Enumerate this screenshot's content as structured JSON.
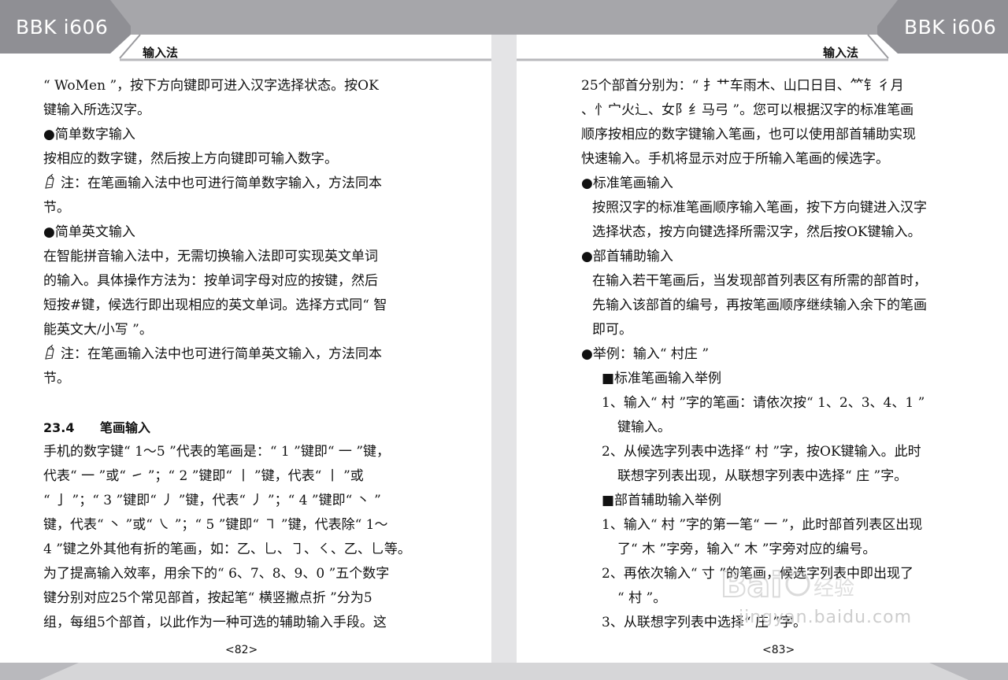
{
  "header": {
    "brand_left": "BBK i606",
    "brand_right": "BBK i606",
    "section_left": "输入法",
    "section_right": "输入法"
  },
  "left_page": {
    "lines": [
      "“ WoMen ”，按下方向键即可进入汉字选择状态。按OK",
      "键输入所选汉字。",
      "●简单数字输入",
      "按相应的数字键，然后按上方向键即可输入数字。",
      "注：在笔画输入法中也可进行简单数字输入，方法同本",
      "节。",
      "●简单英文输入",
      "在智能拼音输入法中，无需切换输入法即可实现英文单词",
      "的输入。具体操作方法为：按单词字母对应的按键，然后",
      "短按#键，候选行即出现相应的英文单词。选择方式同“ 智",
      "能英文大/小写 ”。",
      "注：在笔画输入法中也可进行简单英文输入，方法同本",
      "节。"
    ],
    "heading_number": "23.4",
    "heading_title": "笔画输入",
    "body_lines": [
      "手机的数字键“ 1～5 ”代表的笔画是：“ 1 ”键即“ 一 ”键，",
      "代表“ 一 ”或“ ㇀ ”；“ 2 ”键即“ 丨 ”键，代表“ 丨 ”或",
      "“ 亅 ”；“ 3 ”键即“ 丿 ”键，代表“ 丿 ”；“ 4 ”键即“ 丶 ”",
      "键，代表“ 丶 ”或“ ㇏ ”；“ 5 ”键即“ ㇕ ”键，代表除“ 1～",
      "4 ”键之外其他有折的笔画，如：乙、乚、㇆、㇛、乙、乚等。",
      "为了提高输入效率，用余下的“ 6、7、8、9、0 ”五个数字",
      "键分别对应25个常见部首，按起笔“ 横竖撇点折 ”分为5",
      "组，每组5个部首，以此作为一种可选的辅助输入手段。这"
    ],
    "page_number": "<82>"
  },
  "right_page": {
    "lines": [
      "25个部首分别为：“ 扌艹车雨木、山口日目、⺮钅彳月",
      "、忄宀火辶、女阝纟马弓 ”。您可以根据汉字的标准笔画",
      "顺序按相应的数字键输入笔画，也可以使用部首辅助实现",
      "快速输入。手机将显示对应于所输入笔画的候选字。",
      "●标准笔画输入",
      "按照汉字的标准笔画顺序输入笔画，按下方向键进入汉字",
      "选择状态，按方向键选择所需汉字，然后按OK键输入。",
      "●部首辅助输入",
      "在输入若干笔画后，当发现部首列表区有所需的部首时，",
      "先输入该部首的编号，再按笔画顺序继续输入余下的笔画",
      "即可。",
      "●举例：输入“ 村庄 ”",
      "■标准笔画输入举例",
      "1、输入“ 村 ”字的笔画：请依次按“ 1、2、3、4、1 ”",
      "键输入。",
      "2、从候选字列表中选择“ 村 ”字，按OK键输入。此时",
      "联想字列表出现，从联想字列表中选择“ 庄 ”字。",
      "■部首辅助输入举例",
      "1、输入“ 村 ”字的第一笔“ 一 ”，此时部首列表区出现",
      "了“ 木 ”字旁，输入“ 木 ”字旁对应的编号。",
      "2、再依次输入“ 寸 ”的笔画，候选字列表中即出现了",
      "“ 村 ”。",
      "3、从联想字列表中选择“ 庄 ”字。"
    ],
    "page_number": "<83>"
  },
  "watermark": {
    "logo": "Baidu 经验",
    "url": "jingyan.baidu.com"
  }
}
